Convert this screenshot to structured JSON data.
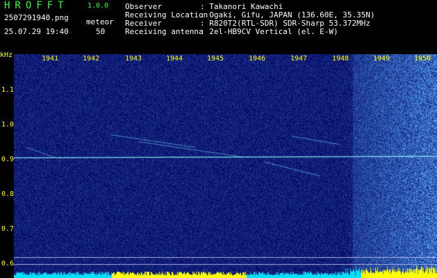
{
  "app": {
    "title": "HROFFT",
    "version": "1.0.0"
  },
  "file": {
    "name": "2507291940.png",
    "datetime": "25.07.29 19:40"
  },
  "meteor": {
    "label": "meteor",
    "count": "50"
  },
  "info": [
    {
      "key": "Observer",
      "value": ": Takanori Kawachi"
    },
    {
      "key": "Receiving Location",
      "value": ": Ogaki, Gifu, JAPAN (136.60E, 35.35N)"
    },
    {
      "key": "Receiver",
      "value": ": R820T2(RTL-SDR) SDR-Sharp 53.372MHz"
    },
    {
      "key": "Receiving antenna",
      "value": ": 2el-HB9CV Vertical (el. E-W)"
    }
  ],
  "axis": {
    "unit": "kHz",
    "yticks": [
      "1.1",
      "1.0",
      "0.9",
      "0.8",
      "0.7",
      "0.6"
    ],
    "xticks": [
      "1941",
      "1942",
      "1943",
      "1944",
      "1945",
      "1946",
      "1947",
      "1948",
      "1949",
      "1950"
    ]
  },
  "colors": {
    "background": "#000060",
    "noise": "#3060ff",
    "echo": "#80ffff",
    "level": "#ffff00",
    "title": "#33ff33",
    "ticklabel": "#ffff00"
  }
}
